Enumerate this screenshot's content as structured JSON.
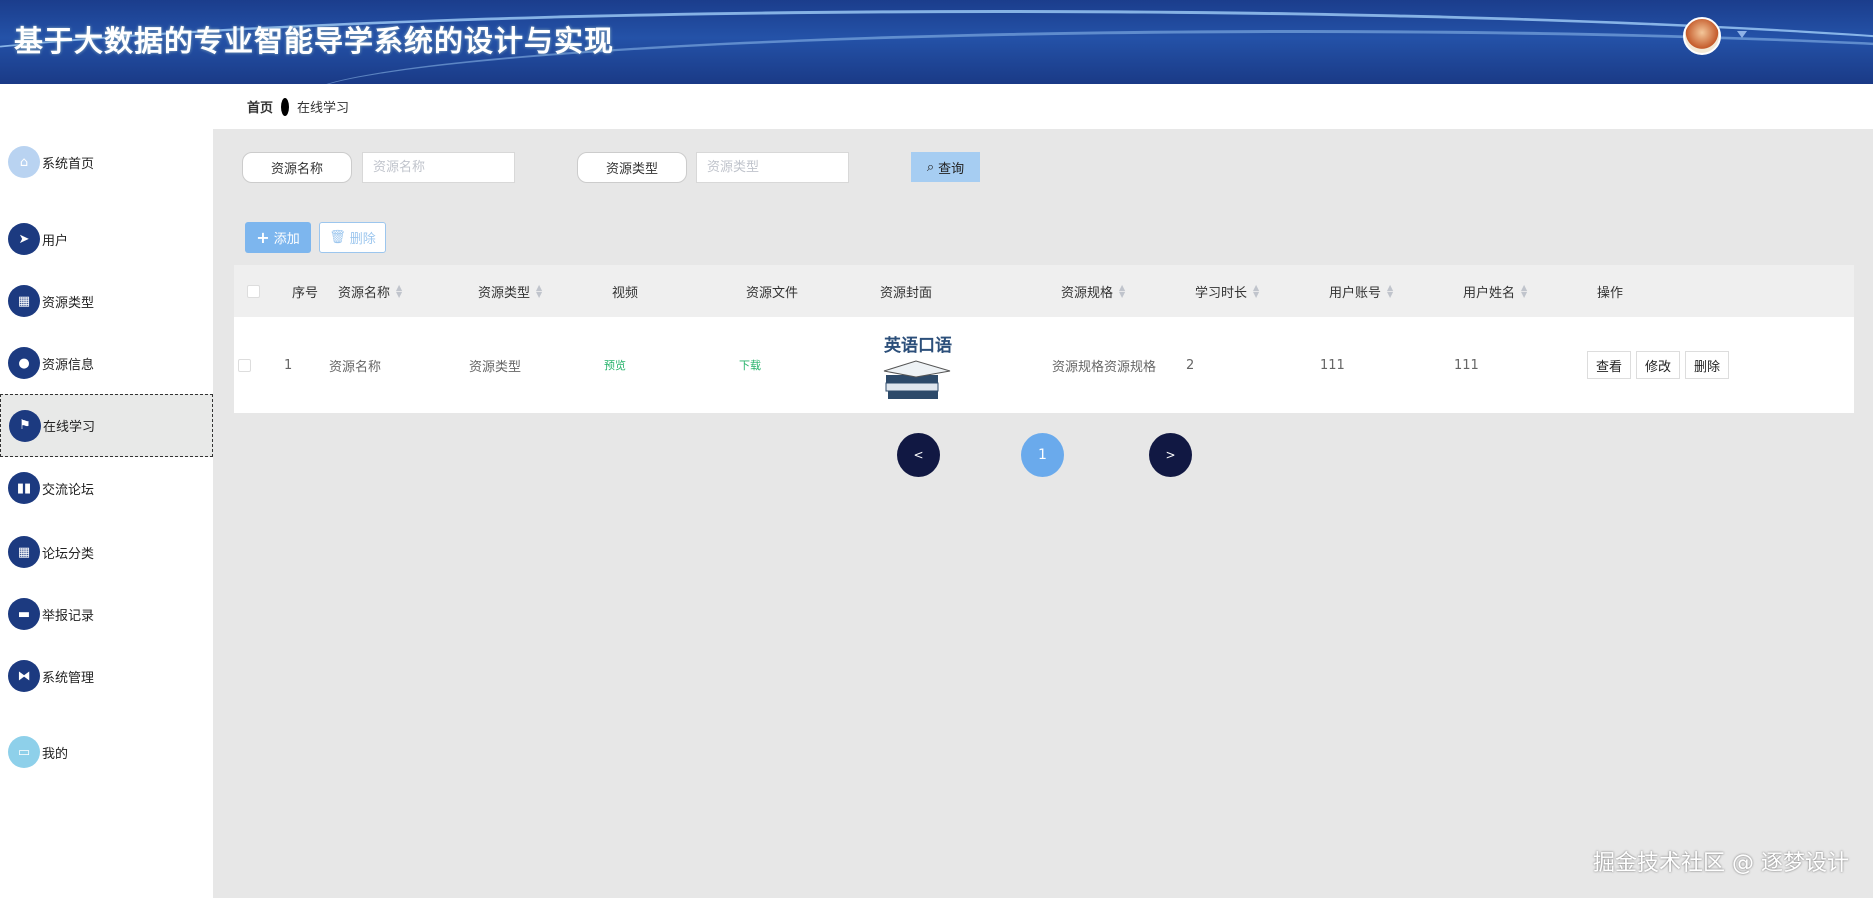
{
  "header": {
    "title": "基于大数据的专业智能导学系统的设计与实现"
  },
  "breadcrumb": {
    "home": "首页",
    "current": "在线学习"
  },
  "sidebar": {
    "items": [
      {
        "label": "系统首页",
        "icon": "home-icon"
      },
      {
        "label": "用户",
        "icon": "paper-plane-icon"
      },
      {
        "label": "资源类型",
        "icon": "grid-icon"
      },
      {
        "label": "资源信息",
        "icon": "location-pin-icon"
      },
      {
        "label": "在线学习",
        "icon": "flag-icon",
        "active": true
      },
      {
        "label": "交流论坛",
        "icon": "books-icon"
      },
      {
        "label": "论坛分类",
        "icon": "grid-icon"
      },
      {
        "label": "举报记录",
        "icon": "monitor-icon"
      },
      {
        "label": "系统管理",
        "icon": "ticket-icon"
      },
      {
        "label": "我的",
        "icon": "card-icon"
      }
    ]
  },
  "search": {
    "name_label": "资源名称",
    "name_placeholder": "资源名称",
    "type_label": "资源类型",
    "type_placeholder": "资源类型",
    "query_label": "查询"
  },
  "toolbar": {
    "add_label": "添加",
    "delete_label": "删除"
  },
  "table": {
    "headers": [
      "序号",
      "资源名称",
      "资源类型",
      "视频",
      "资源文件",
      "资源封面",
      "资源规格",
      "学习时长",
      "用户账号",
      "用户姓名",
      "操作"
    ],
    "rows": [
      {
        "index": "1",
        "name": "资源名称",
        "type": "资源类型",
        "video": "预览",
        "file": "下载",
        "cover_text": "英语口语",
        "spec": "资源规格资源规格",
        "duration": "2",
        "account": "111",
        "username": "111",
        "actions": [
          "查看",
          "修改",
          "删除"
        ]
      }
    ]
  },
  "pagination": {
    "prev": "<",
    "current": "1",
    "next": ">"
  },
  "watermark": "掘金技术社区 @ 逐梦设计",
  "colors": {
    "header": "#1f4698",
    "nav_icon": "#1c3a80",
    "primary": "#7db6ee",
    "link": "#27b36b",
    "page_nav": "#111843"
  }
}
